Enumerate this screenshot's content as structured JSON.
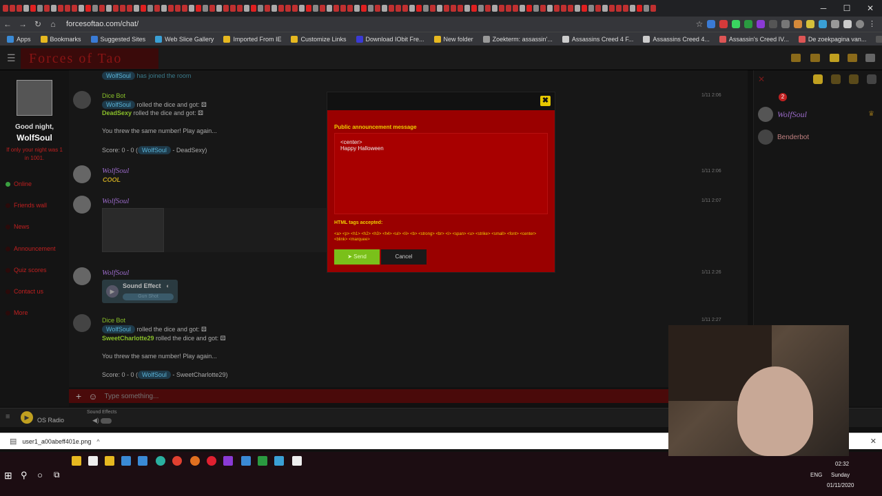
{
  "browser": {
    "url": "forcesoftao.com/chat/",
    "bookmarks": [
      "Apps",
      "Bookmarks",
      "Suggested Sites",
      "Web Slice Gallery",
      "Imported From IE",
      "Customize Links",
      "Download IObit Fre...",
      "New folder",
      "Zoekterm: assassin'...",
      "Assassins Creed 4 F...",
      "Assassins Creed 4...",
      "Assassin's Creed IV...",
      "De zoekpagina van...",
      "Nintendo 64 / N64..."
    ]
  },
  "site": {
    "logo": "Forces of Tao"
  },
  "sidebar": {
    "greeting": "Good night,",
    "username": "WolfSoul",
    "subtext": "If only your night was 1 in 1001.",
    "items": [
      "Online",
      "Friends wall",
      "News",
      "Announcement",
      "Quiz scores",
      "Contact us",
      "More"
    ]
  },
  "chat": {
    "system_join": "WolfSoul",
    "system_join_text": "has joined the room",
    "m1": {
      "name": "Dice Bot",
      "line1_user": "WolfSoul",
      "line1_text": "rolled the dice and got:",
      "line2_user": "DeadSexy",
      "line2_text": "rolled the dice and got:",
      "line3": "You threw the same number! Play again...",
      "score_prefix": "Score: 0 - 0 (",
      "score_user": "WolfSoul",
      "score_suffix": "- DeadSexy)",
      "time": "1/11 2:06"
    },
    "m2": {
      "name": "WolfSoul",
      "text": "COOL",
      "time": "1/11 2:06"
    },
    "m3": {
      "name": "WolfSoul",
      "time": "1/11 2:07"
    },
    "m4": {
      "name": "WolfSoul",
      "sound_title": "Sound Effect",
      "sound_name": "Gun Shot",
      "time": "1/11 2:26"
    },
    "m5": {
      "name": "Dice Bot",
      "line1_user": "WolfSoul",
      "line1_text": "rolled the dice and got:",
      "line2_user": "SweetCharlotte29",
      "line2_text": "rolled the dice and got:",
      "line3": "You threw the same number! Play again...",
      "score_prefix": "Score: 0 - 0 (",
      "score_user": "WolfSoul",
      "score_suffix": "- SweetCharlotte29)",
      "time": "1/11 2:27"
    },
    "input_placeholder": "Type something..."
  },
  "right_panel": {
    "users": [
      "WolfSoul",
      "Benderbot"
    ],
    "badge": "2"
  },
  "player": {
    "radio": "OS Radio",
    "sound_effects": "Sound Effects"
  },
  "modal": {
    "title": "Public announcement message",
    "message": "<center>\nHappy Halloween",
    "tags_title": "HTML tags accepted:",
    "tags": "<a> <p> <h1> <h2> <h3> <h4> <ul> <li> <b> <strong> <br> <i> <span> <u> <strike> <small> <font> <center> <blink> <marquee>",
    "send_label": "Send",
    "cancel_label": "Cancel",
    "close_label": "✖"
  },
  "downloads": {
    "file": "user1_a00abeff401e.png"
  },
  "taskbar": {
    "time": "02:32",
    "day": "Sunday",
    "date": "01/11/2020",
    "lang": "ENG"
  },
  "colors": {
    "modal_bg": "#9a0000",
    "accent_yellow": "#f0d000",
    "send_green": "#7ac01a",
    "chat_green": "#8ac02a",
    "name_purple": "#9a6ac8"
  }
}
